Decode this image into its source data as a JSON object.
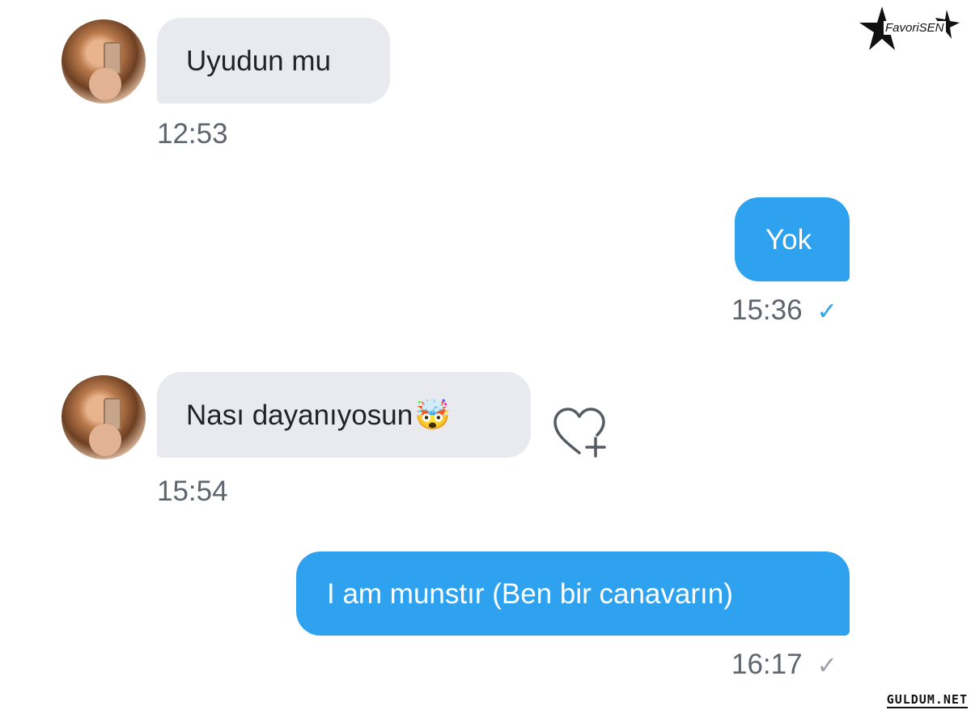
{
  "messages": [
    {
      "from": "them",
      "text": "Uyudun mu",
      "time": "12:53"
    },
    {
      "from": "me",
      "text": "Yok",
      "time": "15:36",
      "status": "read"
    },
    {
      "from": "them",
      "text": "Nası dayanıyosun",
      "emoji": "🤯",
      "time": "15:54"
    },
    {
      "from": "me",
      "text": "I am munstır (Ben bir canavarın)",
      "time": "16:17",
      "status": "sent"
    }
  ],
  "icons": {
    "read_check": "check-icon",
    "sent_check": "check-icon",
    "like": "heart-plus-icon",
    "check_glyph": "✓"
  },
  "watermarks": {
    "top": "FavoriSEN",
    "bottom": "GULDUM.NET"
  },
  "colors": {
    "outgoing_bubble": "#2ea2ef",
    "incoming_bubble": "#e8eaf0",
    "timestamp": "#5e656e"
  }
}
